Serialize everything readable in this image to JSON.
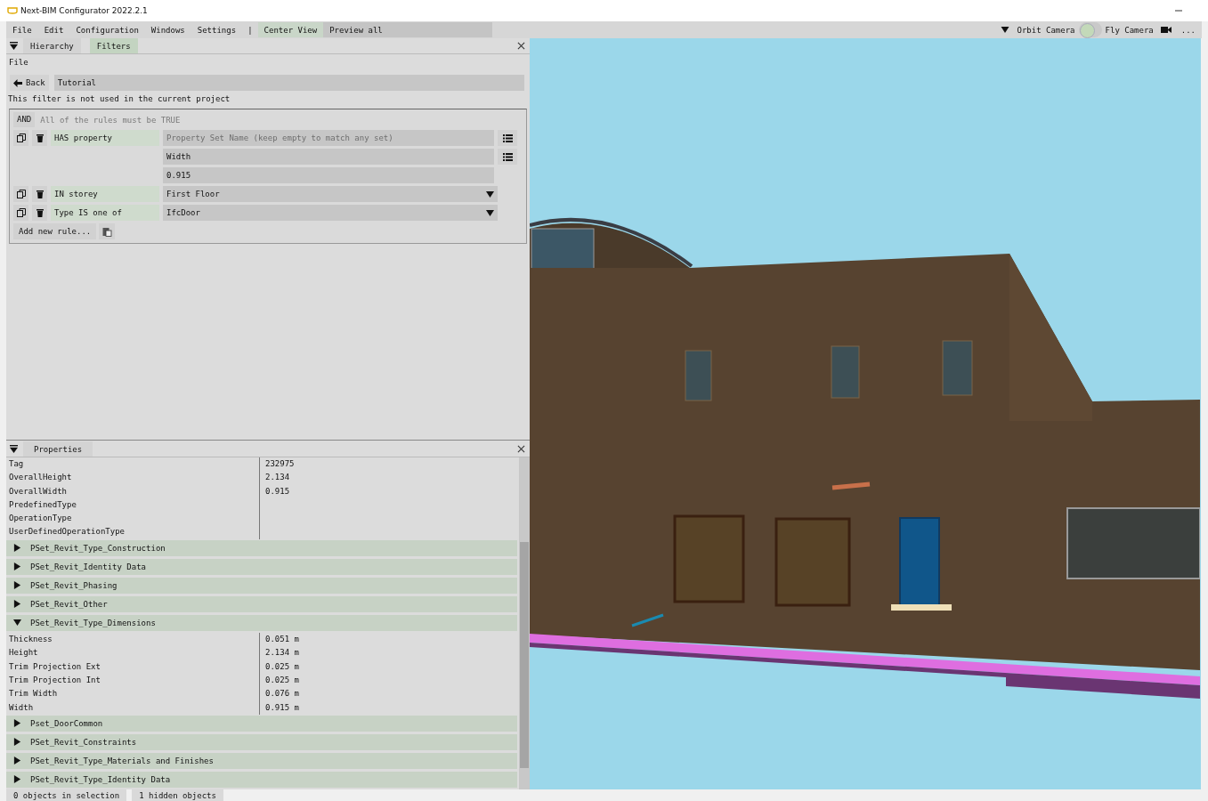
{
  "window": {
    "title": "Next-BIM Configurator 2022.2.1"
  },
  "menu": [
    "File",
    "Edit",
    "Configuration",
    "Windows",
    "Settings"
  ],
  "menu_separator": "|",
  "toolbar": {
    "center_view": "Center View",
    "preview_all": "Preview all",
    "orbit_camera": "Orbit Camera",
    "camera_toggle": {
      "on": false
    },
    "fly_camera": "Fly Camera",
    "more": "..."
  },
  "filters_panel": {
    "tabs": [
      {
        "label": "Hierarchy",
        "selected": false
      },
      {
        "label": "Filters",
        "selected": true
      }
    ],
    "file_label": "File",
    "back": "Back",
    "filter_name": "Tutorial",
    "notice": "This filter is not used in the current project",
    "operator": "AND",
    "operator_hint": "All of the rules must be TRUE",
    "rules": [
      {
        "kind": "property",
        "label": "HAS property",
        "fields": [
          {
            "placeholder": "Property Set Name (keep empty to match any set)",
            "list": true
          },
          {
            "value": "Width",
            "list": true
          },
          {
            "value": "0.915",
            "list": false
          }
        ]
      },
      {
        "kind": "dropdown",
        "label": "IN storey",
        "value": "First Floor"
      },
      {
        "kind": "dropdown",
        "label": "Type IS one of",
        "value": "IfcDoor"
      }
    ],
    "add_rule": "Add new rule..."
  },
  "properties_panel": {
    "title": "Properties",
    "rows": [
      {
        "name": "Tag",
        "value": "232975"
      },
      {
        "name": "OverallHeight",
        "value": "2.134"
      },
      {
        "name": "OverallWidth",
        "value": "0.915"
      },
      {
        "name": "PredefinedType",
        "value": ""
      },
      {
        "name": "OperationType",
        "value": ""
      },
      {
        "name": "UserDefinedOperationType",
        "value": ""
      }
    ],
    "groups": [
      {
        "name": "PSet_Revit_Type_Construction",
        "expanded": false
      },
      {
        "name": "PSet_Revit_Identity Data",
        "expanded": false
      },
      {
        "name": "PSet_Revit_Phasing",
        "expanded": false
      },
      {
        "name": "PSet_Revit_Other",
        "expanded": false
      },
      {
        "name": "PSet_Revit_Type_Dimensions",
        "expanded": true,
        "rows": [
          {
            "name": "Thickness",
            "value": "0.051 m"
          },
          {
            "name": "Height",
            "value": "2.134 m"
          },
          {
            "name": "Trim Projection Ext",
            "value": "0.025 m"
          },
          {
            "name": "Trim Projection Int",
            "value": "0.025 m"
          },
          {
            "name": "Trim Width",
            "value": "0.076 m"
          },
          {
            "name": "Width",
            "value": "0.915 m"
          }
        ]
      },
      {
        "name": "Pset_DoorCommon",
        "expanded": false
      },
      {
        "name": "PSet_Revit_Constraints",
        "expanded": false
      },
      {
        "name": "PSet_Revit_Type_Materials and Finishes",
        "expanded": false
      },
      {
        "name": "PSet_Revit_Type_Identity Data",
        "expanded": false
      }
    ]
  },
  "status_bar": [
    "0 objects in selection",
    "1 hidden objects"
  ]
}
